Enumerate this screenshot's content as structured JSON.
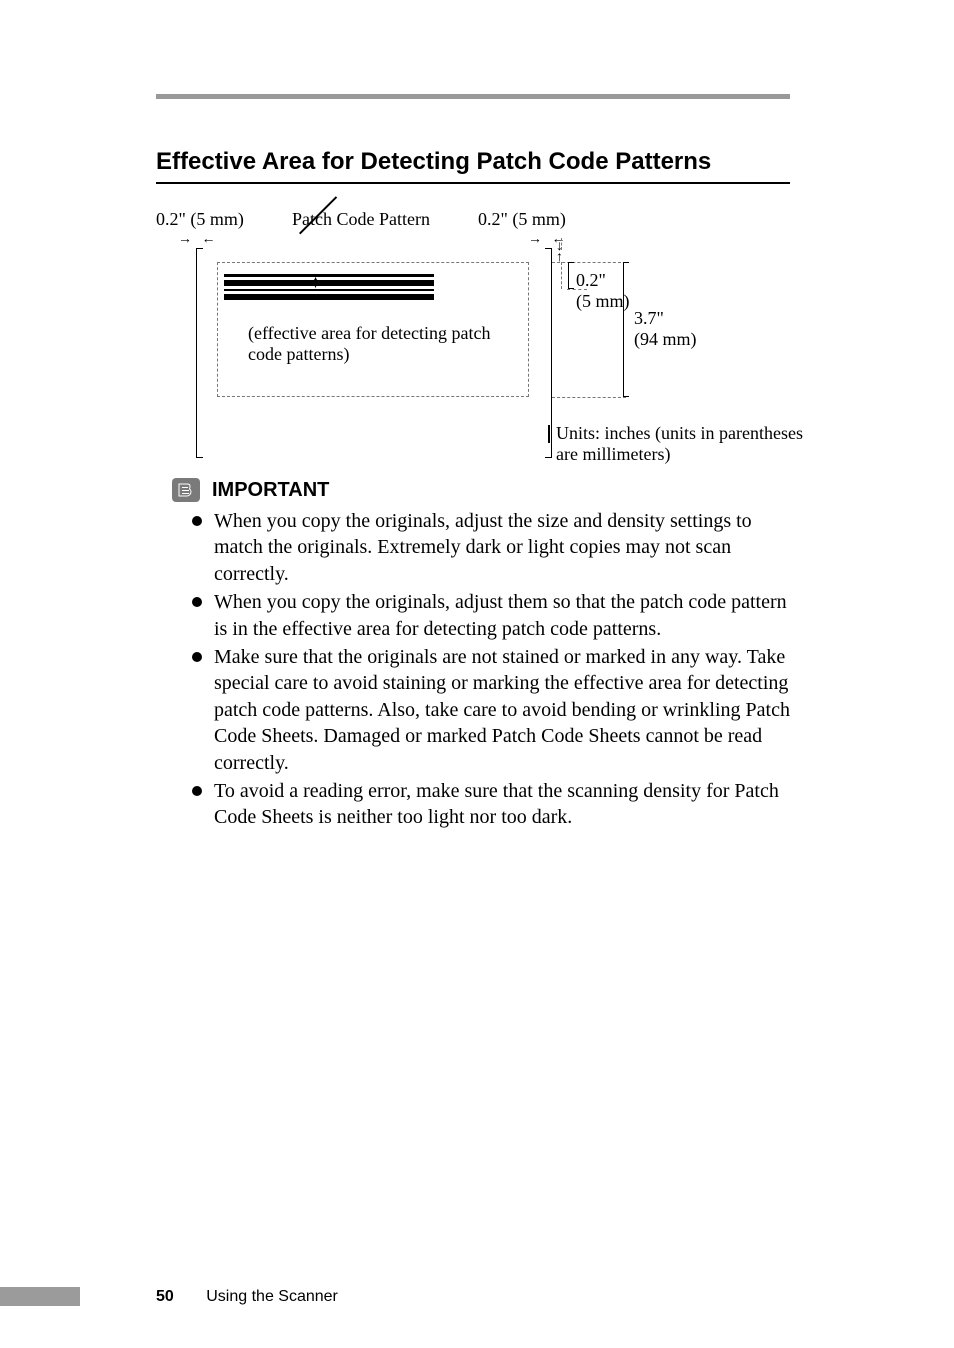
{
  "section_title": "Effective Area for Detecting Patch Code Patterns",
  "diagram": {
    "left_margin": "0.2\" (5 mm)",
    "right_margin": "0.2\" (5 mm)",
    "patch_label": "Patch Code Pattern",
    "effective_caption": "(effective area for detecting patch code patterns)",
    "inner_top_margin": "0.2\"\n(5 mm)",
    "total_height": "3.7\"\n(94 mm)",
    "units_note": "Units: inches (units in parentheses are millimeters)"
  },
  "important": {
    "heading": "IMPORTANT",
    "items": [
      "When you copy the originals, adjust the size and density settings to match the originals. Extremely dark or light copies may not scan correctly.",
      "When you copy the originals, adjust them so that the patch code pattern is in the effective area for detecting patch code patterns.",
      "Make sure that the originals are not stained or marked in any way. Take special care to avoid staining or marking the effective area for detecting patch code patterns. Also, take care to avoid bending or wrinkling Patch Code Sheets. Damaged or marked Patch Code Sheets cannot be read correctly.",
      "To avoid a reading error, make sure that the scanning density for Patch Code Sheets is neither too light nor too dark."
    ]
  },
  "footer": {
    "page_number": "50",
    "running_head": "Using the Scanner"
  }
}
